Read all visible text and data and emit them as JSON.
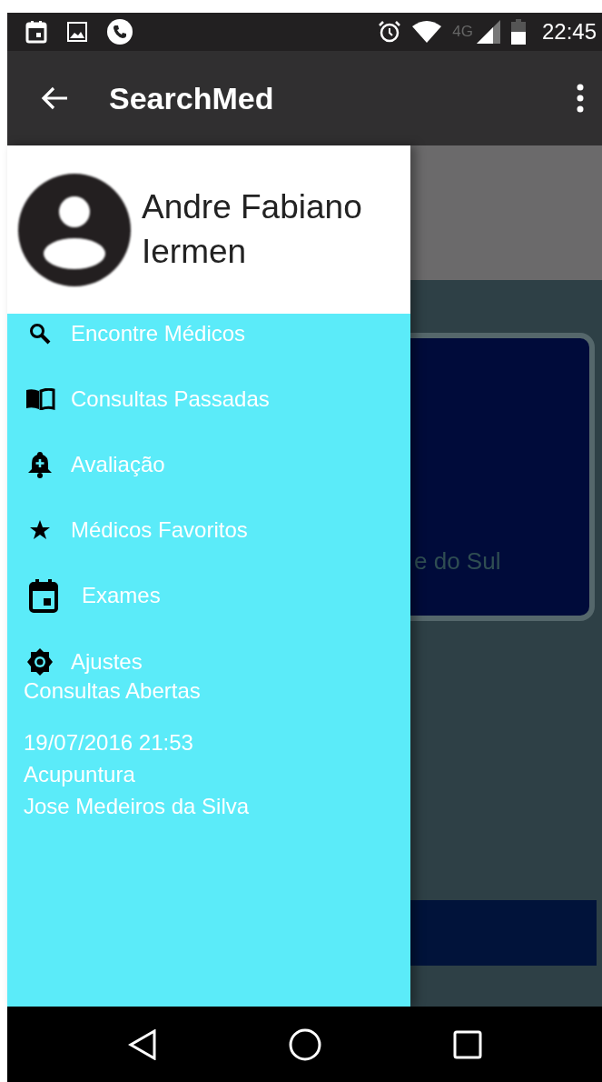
{
  "status_bar": {
    "network": "4G",
    "time": "22:45"
  },
  "app_bar": {
    "title": "SearchMed"
  },
  "drawer": {
    "user_name": "Andre Fabiano Iermen",
    "menu": [
      {
        "kind": "search",
        "label": "Encontre Médicos"
      },
      {
        "kind": "book",
        "label": "Consultas Passadas"
      },
      {
        "kind": "bell",
        "label": "Avaliação"
      },
      {
        "kind": "star",
        "label": "Médicos Favoritos"
      },
      {
        "kind": "calendar",
        "label": "Exames"
      },
      {
        "kind": "gear",
        "label": "Ajustes"
      }
    ],
    "section_title": "Consultas Abertas",
    "appointment": {
      "datetime": "19/07/2016 21:53",
      "specialty": "Acupuntura",
      "doctor": "Jose Medeiros da Silva"
    }
  },
  "background": {
    "card_text": "e do Sul"
  }
}
